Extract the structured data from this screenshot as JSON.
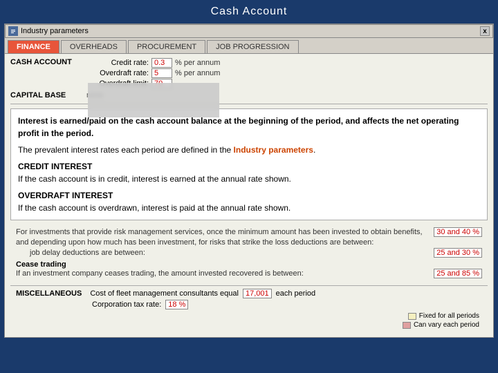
{
  "titleBar": {
    "title": "Cash Account"
  },
  "industryParams": {
    "label": "Industry parameters",
    "closeBtn": "x"
  },
  "tabs": [
    {
      "label": "FINANCE",
      "active": true
    },
    {
      "label": "OVERHEADS",
      "active": false
    },
    {
      "label": "PROCUREMENT",
      "active": false
    },
    {
      "label": "JOB PROGRESSION",
      "active": false
    }
  ],
  "cashAccount": {
    "label": "CASH ACCOUNT",
    "fields": [
      {
        "label": "Credit rate:",
        "value": "0.3",
        "unit": "% per annum"
      },
      {
        "label": "Overdraft rate:",
        "value": "5",
        "unit": "% per annum"
      },
      {
        "label": "Overdraft limit:",
        "value": "70",
        "unit": ""
      }
    ]
  },
  "capitalBase": {
    "label": "CAPITAL BASE",
    "value": "none"
  },
  "infoBox": {
    "mainText": "Interest is earned/paid on the cash account balance at the beginning of the period, and affects the net operating profit in the period.",
    "prevalentText": "The prevalent interest rates each period are defined in the",
    "linkText": "Industry parameters",
    "linkSuffix": ".",
    "creditTitle": "CREDIT INTEREST",
    "creditDesc": "If the cash account is in credit, interest is earned at the annual rate shown.",
    "overdraftTitle": "OVERDRAFT INTEREST",
    "overdraftDesc": "If the cash account is overdrawn, interest is paid at the annual rate shown."
  },
  "investment": {
    "desc1": "For investments that provide risk management services, once the minimum amount has been invested to obtain benefits,",
    "desc2": "and depending upon how much has been investment, for risks that strike the loss deductions are between:",
    "value1": "30 and 40 %",
    "jobDelayLabel": "job delay deductions are between:",
    "value2": "25 and 30 %",
    "ceaseTradingLabel": "Cease trading",
    "ceaseTradingDesc": "If an investment company ceases trading, the amount invested recovered is between:",
    "value3": "25 and 85 %"
  },
  "miscellaneous": {
    "label": "MISCELLANEOUS",
    "field1Label": "Cost of fleet management consultants equal",
    "field1Value": "17,001",
    "field1Unit": "each period",
    "field2Label": "Corporation tax rate:",
    "field2Value": "18 %"
  },
  "legend": [
    {
      "label": "Fixed for all periods",
      "color": "yellow"
    },
    {
      "label": "Can vary each period",
      "color": "pink"
    }
  ]
}
